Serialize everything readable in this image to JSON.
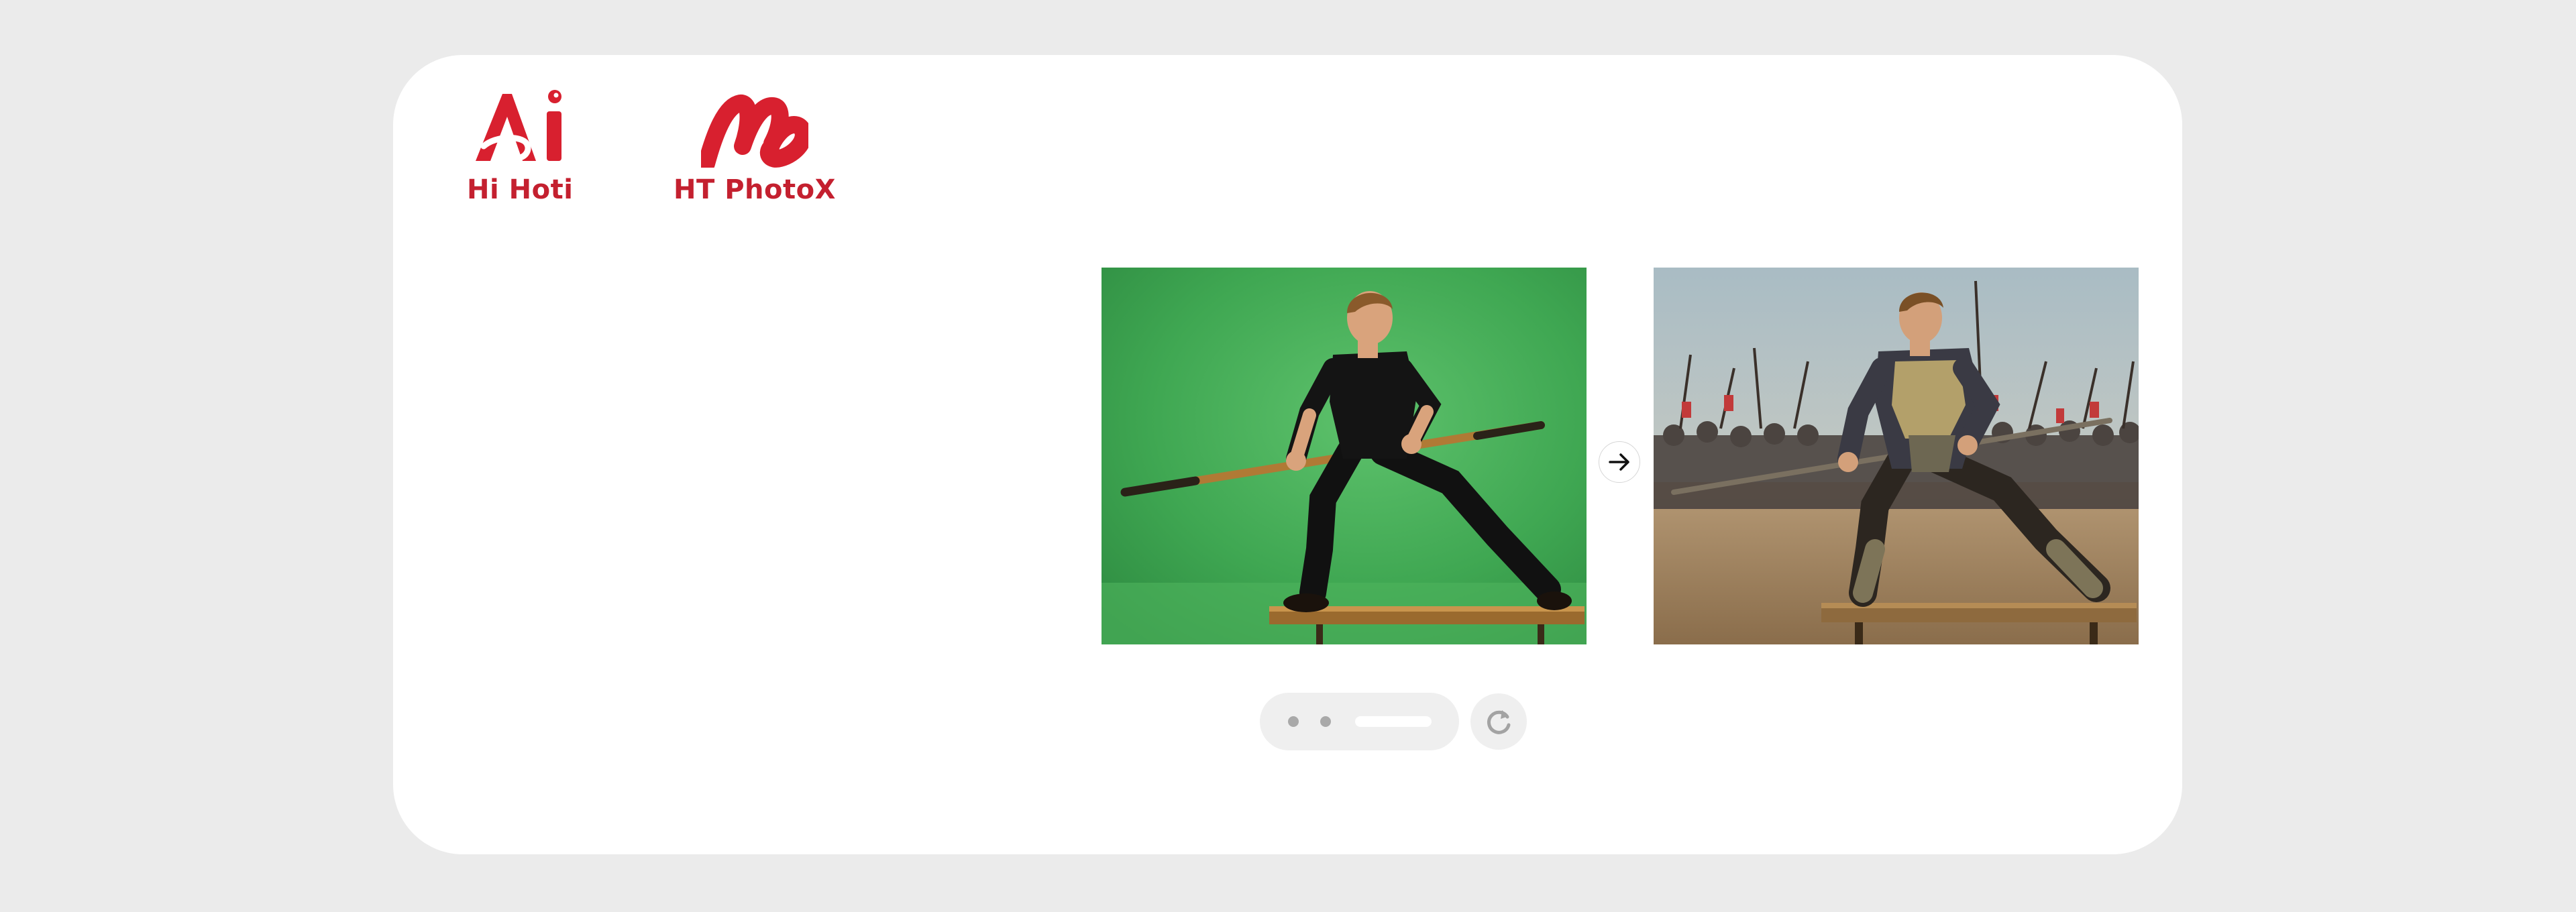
{
  "brands": [
    {
      "name": "Hi Hoti",
      "icon": "ai-logo-icon"
    },
    {
      "name": "HT PhotoX",
      "icon": "m-logo-icon"
    }
  ],
  "comparison": {
    "before_image": "green-screen-spear-man-photo",
    "after_image": "armored-warrior-battlefield-photo",
    "arrow_icon": "arrow-right-icon"
  },
  "carousel": {
    "slide_count": 3,
    "active_index": 2,
    "refresh_icon": "refresh-icon"
  },
  "colors": {
    "brand_red": "#c4202f",
    "background": "#ebebeb",
    "card": "#ffffff",
    "control_bg": "#efefef"
  }
}
